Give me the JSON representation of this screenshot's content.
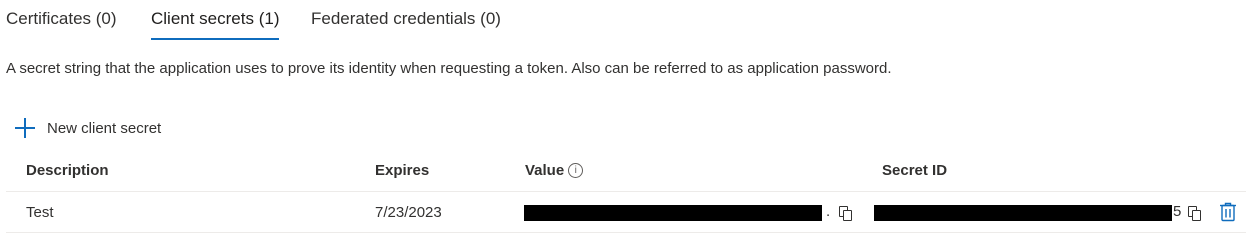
{
  "tabs": [
    {
      "label": "Certificates (0)"
    },
    {
      "label": "Client secrets (1)",
      "active": true
    },
    {
      "label": "Federated credentials (0)"
    }
  ],
  "description": "A secret string that the application uses to prove its identity when requesting a token. Also can be referred to as application password.",
  "toolbar": {
    "new_secret_label": "New client secret",
    "icon": "plus-icon"
  },
  "table": {
    "columns": [
      "Description",
      "Expires",
      "Value",
      "Secret ID"
    ],
    "value_info_icon": "info-icon",
    "rows": [
      {
        "description": "Test",
        "expires": "7/23/2023",
        "value_redacted": true,
        "value_tail": ".",
        "secret_id_redacted": true,
        "secret_id_tail": "5"
      }
    ]
  },
  "colors": {
    "accent": "#0f6cbd",
    "text": "#323130",
    "border": "#edebe9",
    "redaction": "#000000"
  }
}
